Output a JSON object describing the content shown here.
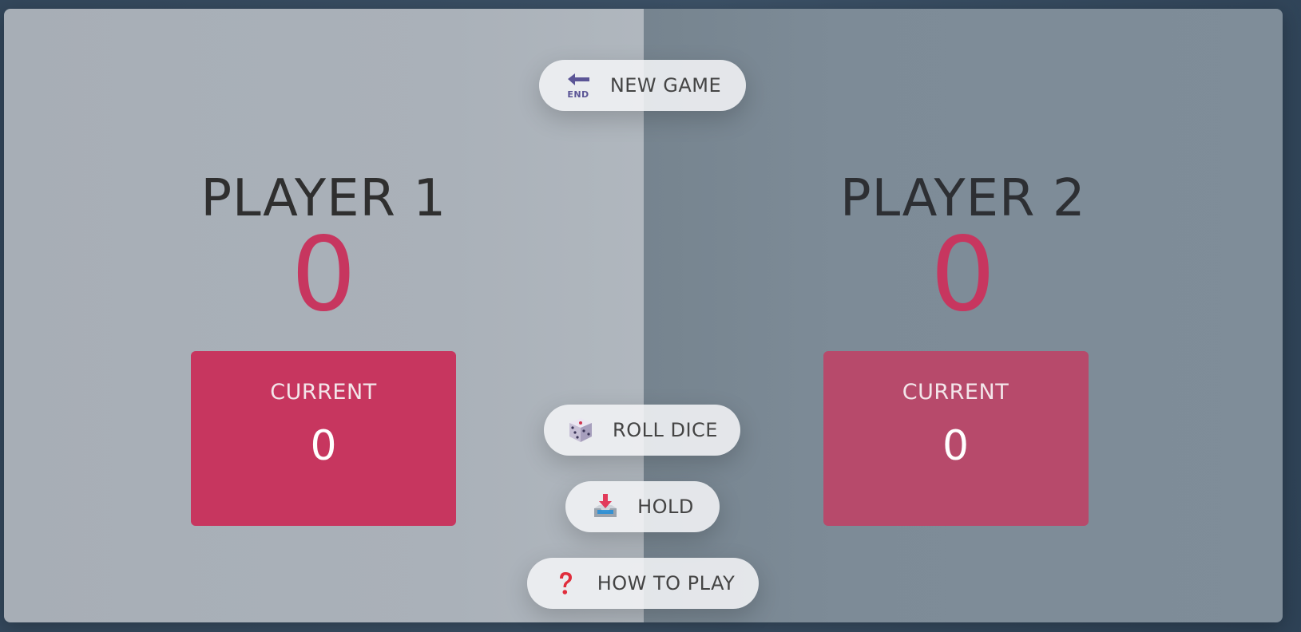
{
  "players": [
    {
      "name": "PLAYER 1",
      "score": "0",
      "current_label": "CURRENT",
      "current_score": "0",
      "active": true
    },
    {
      "name": "PLAYER 2",
      "score": "0",
      "current_label": "CURRENT",
      "current_score": "0",
      "active": false
    }
  ],
  "controls": {
    "new_game": {
      "label": "NEW GAME",
      "icon": "end-arrow-icon"
    },
    "roll_dice": {
      "label": "ROLL DICE",
      "icon": "dice-icon"
    },
    "hold": {
      "label": "HOLD",
      "icon": "inbox-tray-icon"
    },
    "how_to_play": {
      "label": "HOW TO PLAY",
      "icon": "question-mark-icon"
    }
  },
  "colors": {
    "score": "#c7365f",
    "current_active": "#c7365f",
    "current_inactive": "#b74a6b",
    "panel_active": "#aab1b9",
    "panel_inactive": "#7f8d99"
  }
}
